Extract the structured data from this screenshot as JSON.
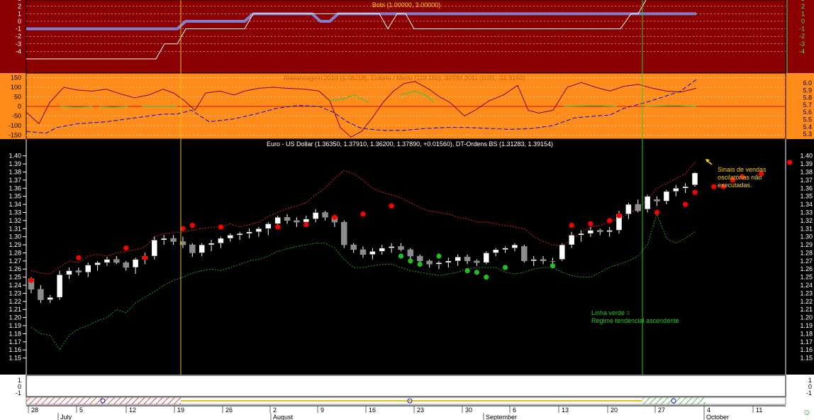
{
  "panels": {
    "bobi": {
      "title": "Bobi (1.00000, 3.00000)",
      "ticks": [
        "3",
        "2",
        "1",
        "0",
        "-1",
        "-2",
        "-3",
        "-4"
      ],
      "right_ticks": [
        "3",
        "2",
        "1",
        "0",
        "-1",
        "-2",
        "-3",
        "-4"
      ],
      "colors": {
        "bg": "#8b0000",
        "thick": "#8080d0",
        "thin": "#ffffff",
        "title": "#ffd000"
      }
    },
    "alav": {
      "title": "Alavancagem 2010 (6.08218), Euforia / Medo (119.150), SPPM 2011 (0.00, -11.9150)",
      "ticks": [
        "150",
        "100",
        "50",
        "0",
        "-50",
        "-100",
        "-150"
      ],
      "right_ticks": [
        "6.0",
        "5.9",
        "5.8",
        "5.7",
        "5.6",
        "5.5",
        "5.4",
        "5.3"
      ]
    },
    "price": {
      "title": "Euro - US Dollar (1.36350, 1.37910, 1.36200, 1.37890, +0.01560), DT-Ordens BS (1.31283, 1.39154)",
      "ticks": [
        "1.40",
        "1.39",
        "1.38",
        "1.37",
        "1.36",
        "1.35",
        "1.34",
        "1.33",
        "1.32",
        "1.31",
        "1.30",
        "1.29",
        "1.28",
        "1.27",
        "1.26",
        "1.25",
        "1.24",
        "1.23",
        "1.22",
        "1.21",
        "1.20",
        "1.19",
        "1.18",
        "1.17",
        "1.16",
        "1.15"
      ],
      "annotation_sell": "Sinais de vendas\noscilatórias não\nexecutadas.",
      "annotation_green": "Linha verde =\nRegime tendencial ascendente",
      "ylim": [
        1.14,
        1.405
      ]
    },
    "small": {
      "ticks": [
        "1",
        "0",
        "-1"
      ]
    }
  },
  "axis": {
    "days": [
      "28",
      "5",
      "12",
      "19",
      "26",
      "2",
      "9",
      "16",
      "23",
      "30",
      "6",
      "13",
      "20",
      "27",
      "4",
      "11"
    ],
    "months": [
      "July",
      "August",
      "September",
      "October"
    ]
  },
  "candles": [
    [
      1.248,
      1.25,
      1.23,
      1.235
    ],
    [
      1.235,
      1.24,
      1.218,
      1.222
    ],
    [
      1.222,
      1.228,
      1.218,
      1.225
    ],
    [
      1.225,
      1.258,
      1.222,
      1.253
    ],
    [
      1.253,
      1.262,
      1.248,
      1.258
    ],
    [
      1.258,
      1.262,
      1.252,
      1.256
    ],
    [
      1.256,
      1.268,
      1.25,
      1.265
    ],
    [
      1.265,
      1.27,
      1.258,
      1.268
    ],
    [
      1.268,
      1.275,
      1.264,
      1.272
    ],
    [
      1.272,
      1.276,
      1.266,
      1.268
    ],
    [
      1.268,
      1.27,
      1.258,
      1.262
    ],
    [
      1.262,
      1.274,
      1.254,
      1.272
    ],
    [
      1.272,
      1.28,
      1.266,
      1.276
    ],
    [
      1.276,
      1.3,
      1.272,
      1.296
    ],
    [
      1.296,
      1.302,
      1.29,
      1.298
    ],
    [
      1.298,
      1.302,
      1.29,
      1.294
    ],
    [
      1.294,
      1.3,
      1.286,
      1.29
    ],
    [
      1.29,
      1.292,
      1.275,
      1.28
    ],
    [
      1.28,
      1.292,
      1.276,
      1.29
    ],
    [
      1.29,
      1.296,
      1.282,
      1.292
    ],
    [
      1.292,
      1.3,
      1.286,
      1.298
    ],
    [
      1.298,
      1.304,
      1.294,
      1.302
    ],
    [
      1.302,
      1.306,
      1.296,
      1.304
    ],
    [
      1.304,
      1.31,
      1.298,
      1.306
    ],
    [
      1.306,
      1.312,
      1.3,
      1.31
    ],
    [
      1.31,
      1.318,
      1.302,
      1.316
    ],
    [
      1.316,
      1.326,
      1.31,
      1.324
    ],
    [
      1.324,
      1.328,
      1.316,
      1.32
    ],
    [
      1.32,
      1.324,
      1.312,
      1.318
    ],
    [
      1.318,
      1.326,
      1.314,
      1.322
    ],
    [
      1.322,
      1.334,
      1.318,
      1.33
    ],
    [
      1.33,
      1.332,
      1.32,
      1.324
    ],
    [
      1.324,
      1.326,
      1.312,
      1.318
    ],
    [
      1.318,
      1.32,
      1.286,
      1.29
    ],
    [
      1.29,
      1.292,
      1.28,
      1.284
    ],
    [
      1.284,
      1.288,
      1.274,
      1.278
    ],
    [
      1.278,
      1.286,
      1.272,
      1.282
    ],
    [
      1.282,
      1.29,
      1.278,
      1.286
    ],
    [
      1.286,
      1.292,
      1.28,
      1.288
    ],
    [
      1.288,
      1.292,
      1.282,
      1.284
    ],
    [
      1.284,
      1.286,
      1.272,
      1.276
    ],
    [
      1.276,
      1.278,
      1.266,
      1.27
    ],
    [
      1.27,
      1.272,
      1.262,
      1.266
    ],
    [
      1.266,
      1.27,
      1.26,
      1.268
    ],
    [
      1.268,
      1.274,
      1.262,
      1.27
    ],
    [
      1.27,
      1.278,
      1.264,
      1.275
    ],
    [
      1.275,
      1.278,
      1.266,
      1.27
    ],
    [
      1.27,
      1.272,
      1.264,
      1.268
    ],
    [
      1.268,
      1.282,
      1.266,
      1.28
    ],
    [
      1.28,
      1.286,
      1.276,
      1.284
    ],
    [
      1.284,
      1.288,
      1.28,
      1.286
    ],
    [
      1.286,
      1.292,
      1.282,
      1.29
    ],
    [
      1.288,
      1.29,
      1.268,
      1.27
    ],
    [
      1.27,
      1.276,
      1.264,
      1.272
    ],
    [
      1.272,
      1.276,
      1.266,
      1.27
    ],
    [
      1.27,
      1.274,
      1.266,
      1.27
    ],
    [
      1.272,
      1.292,
      1.27,
      1.29
    ],
    [
      1.29,
      1.306,
      1.286,
      1.302
    ],
    [
      1.302,
      1.308,
      1.294,
      1.304
    ],
    [
      1.304,
      1.312,
      1.3,
      1.308
    ],
    [
      1.308,
      1.31,
      1.302,
      1.306
    ],
    [
      1.306,
      1.312,
      1.3,
      1.308
    ],
    [
      1.308,
      1.332,
      1.304,
      1.328
    ],
    [
      1.328,
      1.342,
      1.322,
      1.34
    ],
    [
      1.34,
      1.346,
      1.33,
      1.332
    ],
    [
      1.334,
      1.352,
      1.33,
      1.35
    ],
    [
      1.346,
      1.35,
      1.338,
      1.344
    ],
    [
      1.344,
      1.358,
      1.34,
      1.356
    ],
    [
      1.356,
      1.364,
      1.35,
      1.36
    ],
    [
      1.36,
      1.366,
      1.354,
      1.362
    ],
    [
      1.364,
      1.38,
      1.362,
      1.379
    ]
  ],
  "bands": {
    "upper": [
      1.258,
      1.255,
      1.254,
      1.262,
      1.27,
      1.268,
      1.276,
      1.278,
      1.276,
      1.28,
      1.282,
      1.284,
      1.287,
      1.3,
      1.304,
      1.305,
      1.306,
      1.308,
      1.31,
      1.312,
      1.312,
      1.316,
      1.312,
      1.315,
      1.318,
      1.325,
      1.33,
      1.335,
      1.338,
      1.342,
      1.352,
      1.36,
      1.372,
      1.382,
      1.378,
      1.37,
      1.36,
      1.355,
      1.352,
      1.348,
      1.342,
      1.336,
      1.332,
      1.33,
      1.328,
      1.324,
      1.322,
      1.318,
      1.318,
      1.316,
      1.314,
      1.312,
      1.31,
      1.3,
      1.294,
      1.29,
      1.289,
      1.296,
      1.305,
      1.312,
      1.314,
      1.318,
      1.322,
      1.328,
      1.336,
      1.346,
      1.36,
      1.366,
      1.372,
      1.378,
      1.392
    ],
    "lower": [
      1.188,
      1.18,
      1.178,
      1.16,
      1.178,
      1.186,
      1.19,
      1.196,
      1.2,
      1.21,
      1.206,
      1.218,
      1.225,
      1.232,
      1.24,
      1.246,
      1.25,
      1.255,
      1.258,
      1.26,
      1.258,
      1.262,
      1.266,
      1.27,
      1.272,
      1.276,
      1.282,
      1.285,
      1.288,
      1.29,
      1.292,
      1.292,
      1.286,
      1.272,
      1.262,
      1.262,
      1.264,
      1.266,
      1.266,
      1.262,
      1.258,
      1.256,
      1.254,
      1.252,
      1.254,
      1.256,
      1.26,
      1.262,
      1.262,
      1.262,
      1.256,
      1.254,
      1.256,
      1.26,
      1.262,
      1.262,
      1.256,
      1.252,
      1.25,
      1.25,
      1.256,
      1.262,
      1.266,
      1.27,
      1.276,
      1.29,
      1.328,
      1.298,
      1.292,
      1.298,
      1.306
    ]
  },
  "sell_dots": [
    [
      0,
      1.246
    ],
    [
      5,
      1.274
    ],
    [
      10,
      1.286
    ],
    [
      12,
      1.274
    ],
    [
      16,
      1.31
    ],
    [
      17,
      1.314
    ],
    [
      20,
      1.312
    ],
    [
      26,
      1.312
    ],
    [
      29,
      1.315
    ],
    [
      32,
      1.324
    ],
    [
      35,
      1.328
    ],
    [
      38,
      1.338
    ],
    [
      57,
      1.314
    ],
    [
      59,
      1.316
    ],
    [
      61,
      1.32
    ],
    [
      62,
      1.326
    ],
    [
      66,
      1.33
    ],
    [
      69,
      1.34
    ],
    [
      70,
      1.355
    ],
    [
      72,
      1.362
    ],
    [
      73,
      1.362
    ],
    [
      74,
      1.37
    ],
    [
      75,
      1.374
    ],
    [
      77,
      1.378
    ],
    [
      80,
      1.392
    ]
  ],
  "buy_dots": [
    [
      39,
      1.276
    ],
    [
      40,
      1.27
    ],
    [
      41,
      1.266
    ],
    [
      43,
      1.276
    ],
    [
      46,
      1.258
    ],
    [
      47,
      1.256
    ],
    [
      48,
      1.25
    ],
    [
      50,
      1.262
    ],
    [
      55,
      1.264
    ]
  ],
  "colors": {
    "up": "#ffffff",
    "down": "#8c8c8c",
    "upper_band": "#e02020",
    "lower_band": "#20a020",
    "sell": "#ff0000",
    "buy": "#20c020",
    "vline_yellow": "#e8c020",
    "vline_green": "#20d020"
  }
}
